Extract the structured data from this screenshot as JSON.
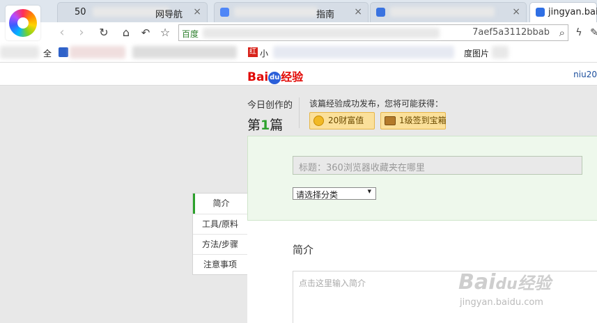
{
  "browser": {
    "tabs": [
      {
        "title": "50",
        "title2": "网导航"
      },
      {
        "title": "指南"
      },
      {
        "title": ""
      },
      {
        "title": "jingyan.baid"
      }
    ],
    "address": {
      "label": "百度",
      "text": "7aef5a3112bbab"
    },
    "bookmarks": {
      "item_all": "全",
      "item_small": "小",
      "item_images": "度图片"
    }
  },
  "page": {
    "brand": {
      "bai": "Bai",
      "paw": "du",
      "jingyan": "经验"
    },
    "user": "niu20",
    "creation": {
      "today_label": "今日创作的",
      "prefix": "第",
      "count": "1",
      "suffix": "篇"
    },
    "reward": {
      "text": "该篇经验成功发布，您将可能获得：",
      "badge_wealth": "20财富值",
      "badge_chest": "1级签到宝箱"
    },
    "form": {
      "title_placeholder": "标题：360浏览器收藏夹在哪里",
      "category_select": "请选择分类"
    },
    "sidenav": [
      "简介",
      "工具/原料",
      "方法/步骤",
      "注意事项"
    ],
    "section_title": "简介",
    "intro_placeholder": "点击这里输入简介",
    "watermark": {
      "main": "Bai",
      "paw": "du",
      "jy": "经验",
      "url": "jingyan.baidu.com"
    }
  },
  "colors": {
    "brand_red": "#e10602",
    "accent_green": "#2ca12c",
    "badge_gold": "#fbe09a"
  }
}
